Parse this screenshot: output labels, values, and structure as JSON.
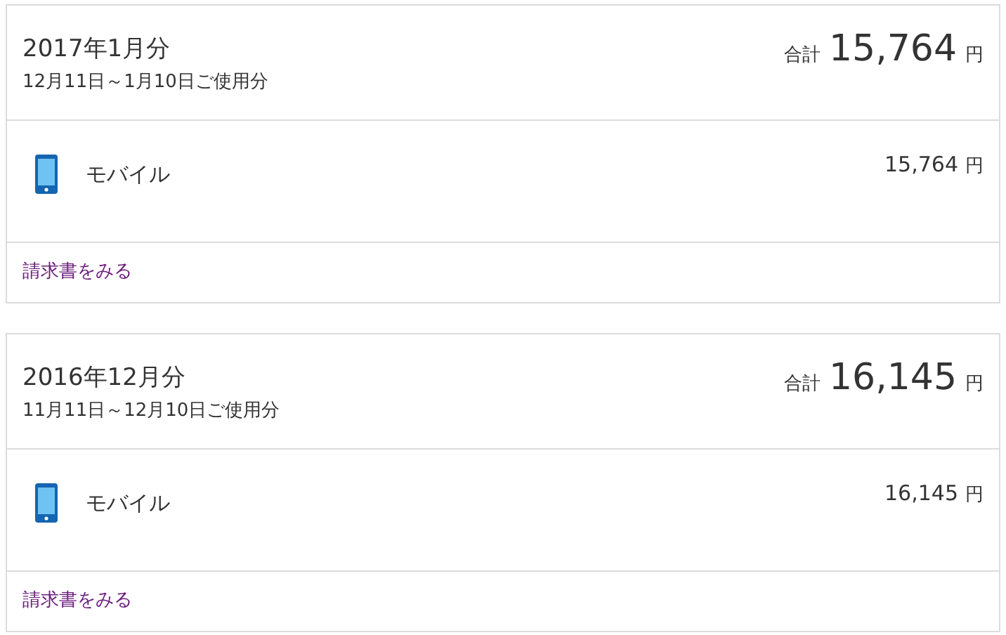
{
  "bills": [
    {
      "month": "2017年1月分",
      "period": "12月11日～1月10日ご使用分",
      "total_label": "合計",
      "total": "15,764",
      "total_unit": "円",
      "items": [
        {
          "kind": "mobile",
          "name": "モバイル",
          "amount": "15,764",
          "unit": "円"
        }
      ],
      "link": "請求書をみる"
    },
    {
      "month": "2016年12月分",
      "period": "11月11日～12月10日ご使用分",
      "total_label": "合計",
      "total": "16,145",
      "total_unit": "円",
      "items": [
        {
          "kind": "mobile",
          "name": "モバイル",
          "amount": "16,145",
          "unit": "円"
        }
      ],
      "link": "請求書をみる"
    }
  ]
}
